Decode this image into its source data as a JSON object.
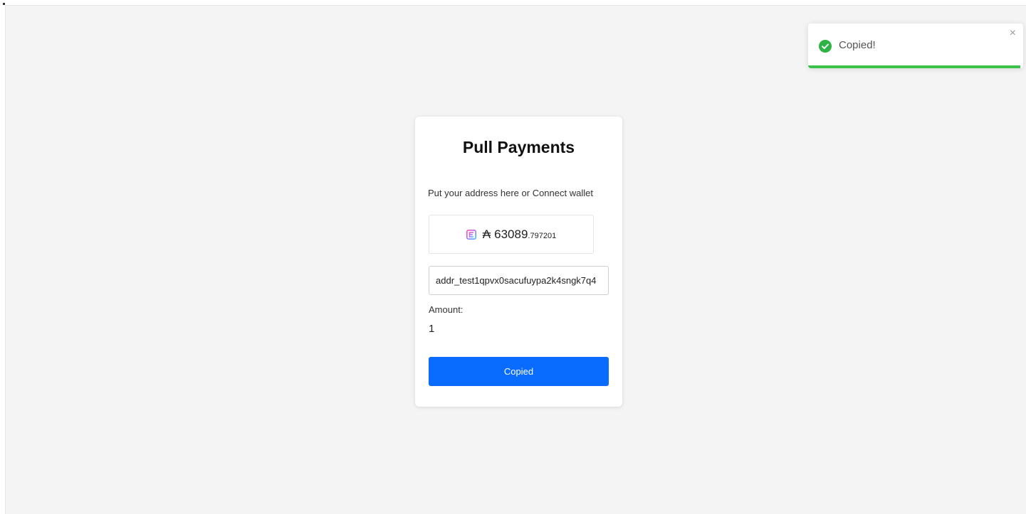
{
  "card": {
    "title": "Pull Payments",
    "subtitle": "Put your address here or Connect wallet",
    "wallet": {
      "icon": "wallet-app-icon",
      "currency_symbol": "₳",
      "balance_integer": "63089",
      "balance_decimal": ".797201"
    },
    "address_input": {
      "value": "addr_test1qpvx0sacufuypa2k4sngk7q4"
    },
    "amount_label": "Amount:",
    "amount_value": "1",
    "button_label": "Copied"
  },
  "toast": {
    "icon": "check-circle-icon",
    "message": "Copied!",
    "close": "×",
    "progress_percent": 98.6
  },
  "colors": {
    "background": "#f4f4f4",
    "accent": "#0a6cff",
    "success": "#3bc24a"
  }
}
